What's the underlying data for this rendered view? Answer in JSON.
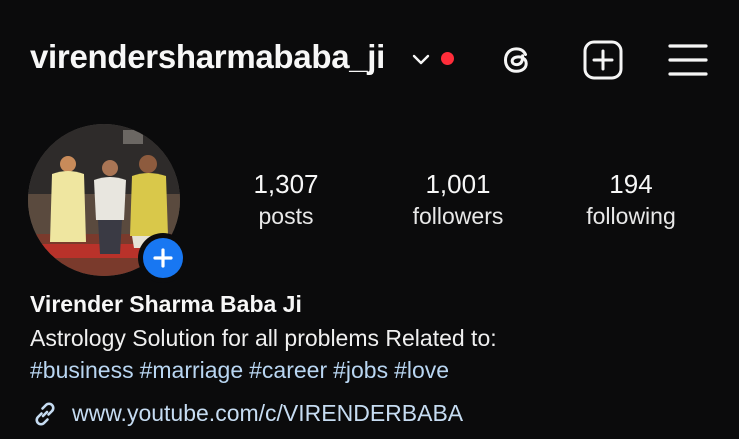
{
  "header": {
    "username": "virendersharmababa_ji",
    "icons": [
      "chevron-down-icon",
      "notification-dot",
      "threads-icon",
      "new-post-icon",
      "menu-icon"
    ]
  },
  "profile": {
    "avatar": "profile-photo",
    "stats": {
      "posts": {
        "value": "1,307",
        "label": "posts"
      },
      "followers": {
        "value": "1,001",
        "label": "followers"
      },
      "following": {
        "value": "194",
        "label": "following"
      }
    },
    "name": "Virender Sharma Baba Ji",
    "bio": "Astrology Solution for all problems Related to:",
    "hashtags": [
      "#business",
      "#marriage",
      "#career",
      "#jobs",
      "#love"
    ],
    "link": "www.youtube.com/c/VIRENDERBABA"
  },
  "colors": {
    "background": "#0b0b0c",
    "accent_blue": "#1877f2",
    "notification_red": "#ff2d3a",
    "hashtag": "#b9d6f2"
  }
}
